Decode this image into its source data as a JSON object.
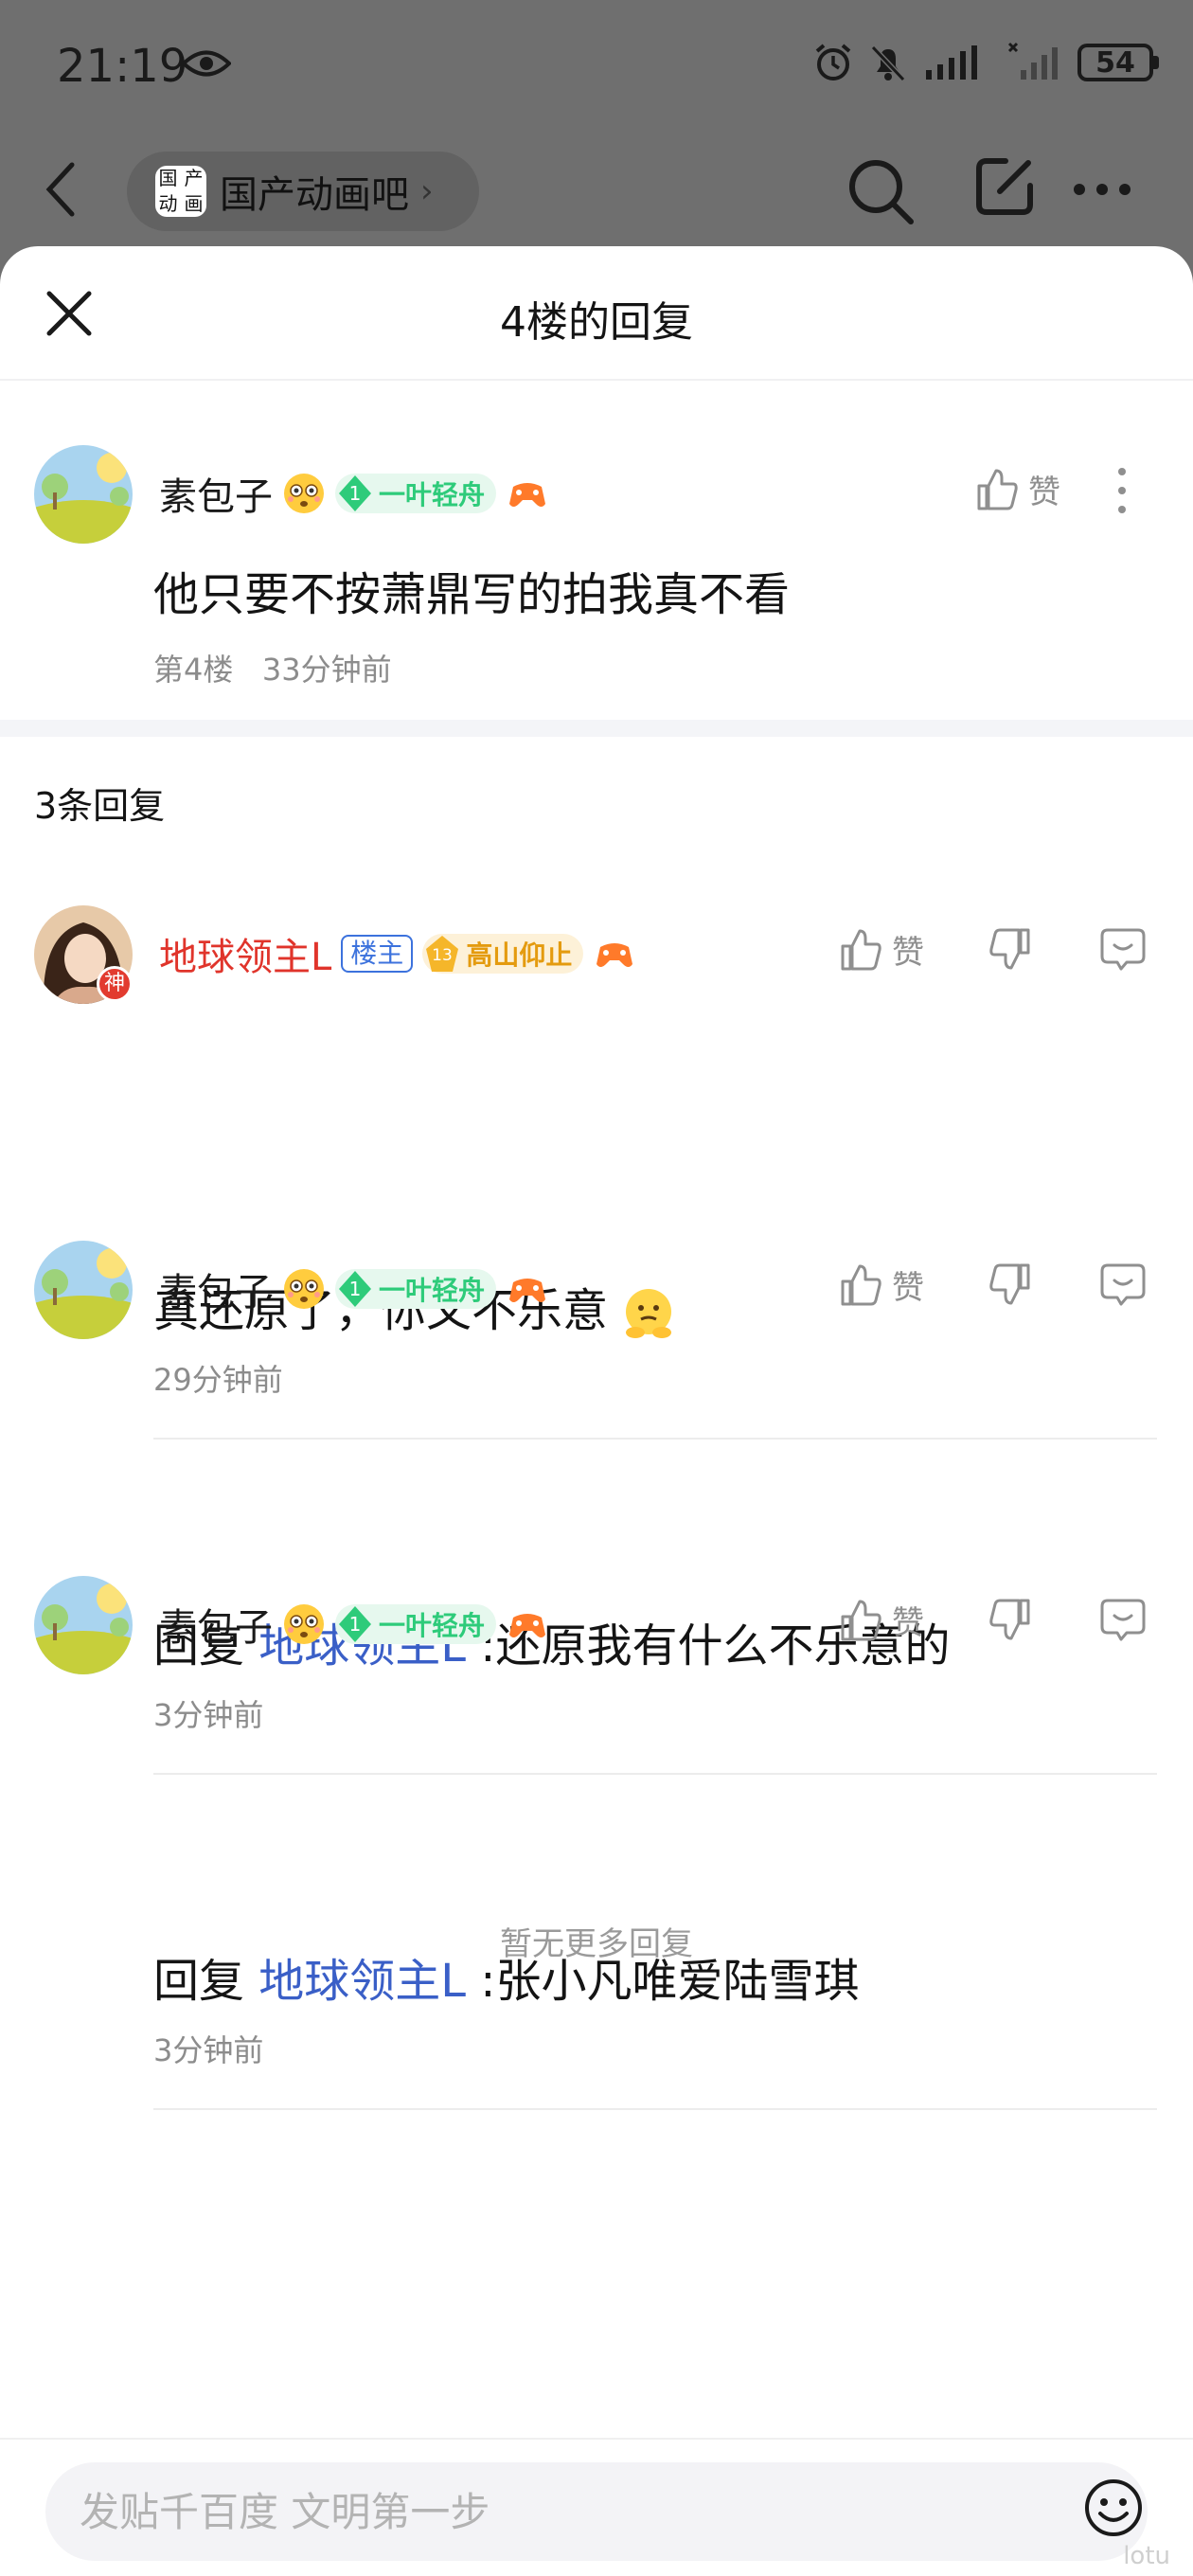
{
  "status_bar": {
    "time": "21:19",
    "battery": "54"
  },
  "background": {
    "forum_name": "国产动画吧",
    "forum_logo_chars": [
      "国",
      "产",
      "动",
      "画"
    ]
  },
  "sheet": {
    "title": "4楼的回复"
  },
  "main_post": {
    "username": "素包子",
    "level_num": "1",
    "level_title": "一叶轻舟",
    "content": "他只要不按萧鼎写的拍我真不看",
    "floor": "第4楼",
    "time": "33分钟前",
    "like_label": "赞"
  },
  "reply_count": "3条回复",
  "replies": [
    {
      "username": "地球领主L",
      "owner_tag": "楼主",
      "avatar_badge": "神",
      "level_num": "13",
      "level_title": "高山仰止",
      "content": "真还原了，你又不乐意",
      "time": "29分钟前",
      "like_label": "赞"
    },
    {
      "username": "素包子",
      "level_num": "1",
      "level_title": "一叶轻舟",
      "reply_prefix": "回复",
      "mention": "地球领主L",
      "content": ":还原我有什么不乐意的",
      "time": "3分钟前",
      "like_label": "赞"
    },
    {
      "username": "素包子",
      "level_num": "1",
      "level_title": "一叶轻舟",
      "reply_prefix": "回复",
      "mention": "地球领主L",
      "content": ":张小凡唯爱陆雪琪",
      "time": "3分钟前",
      "like_label": "赞"
    }
  ],
  "no_more": "暂无更多回复",
  "input": {
    "placeholder": "发贴千百度 文明第一步"
  },
  "watermark": "lotu"
}
